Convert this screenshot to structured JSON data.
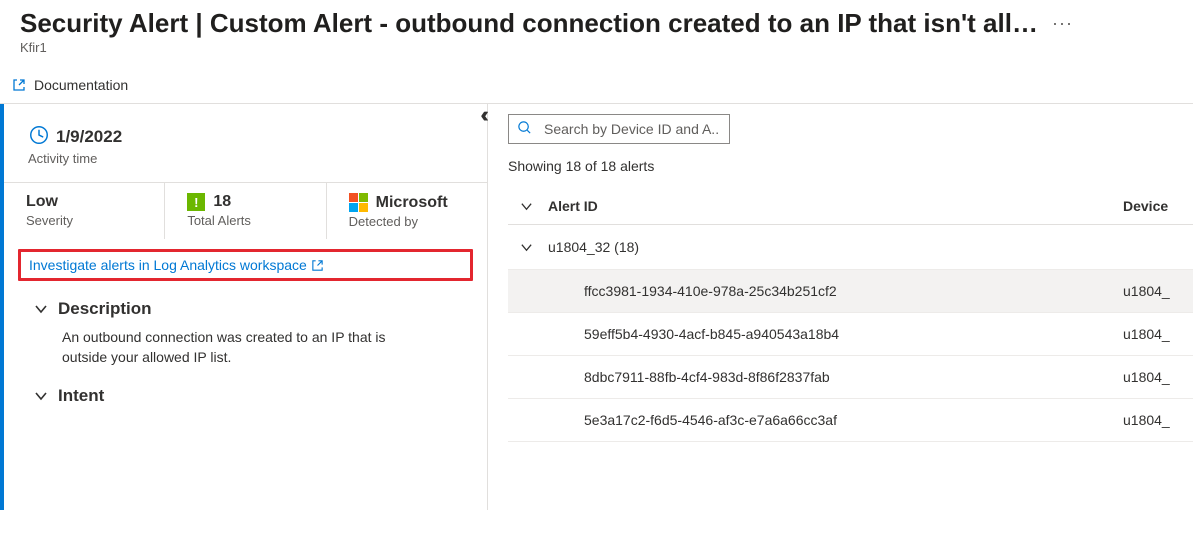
{
  "header": {
    "title": "Security Alert | Custom Alert - outbound connection created to an IP that isn't allowed",
    "subtitle": "Kfir1",
    "more_label": "···"
  },
  "toolbar": {
    "documentation_label": "Documentation"
  },
  "left": {
    "activity_date": "1/9/2022",
    "activity_label": "Activity time",
    "severity_value": "Low",
    "severity_label": "Severity",
    "total_alerts_value": "18",
    "total_alerts_label": "Total Alerts",
    "detected_value": "Microsoft",
    "detected_label": "Detected by",
    "investigate_link": "Investigate alerts in Log Analytics workspace",
    "description_head": "Description",
    "description_body": "An outbound connection was created to an IP that is outside your allowed IP list.",
    "intent_head": "Intent"
  },
  "right": {
    "search_placeholder": "Search by Device ID and A...",
    "results_count": "Showing 18 of 18 alerts",
    "columns": {
      "alert_id": "Alert ID",
      "device": "Device "
    },
    "group": {
      "label": "u1804_32 (18)"
    },
    "rows": [
      {
        "alert_id": "ffcc3981-1934-410e-978a-25c34b251cf2",
        "device": "u1804_"
      },
      {
        "alert_id": "59eff5b4-4930-4acf-b845-a940543a18b4",
        "device": "u1804_"
      },
      {
        "alert_id": "8dbc7911-88fb-4cf4-983d-8f86f2837fab",
        "device": "u1804_"
      },
      {
        "alert_id": "5e3a17c2-f6d5-4546-af3c-e7a6a66cc3af",
        "device": "u1804_"
      }
    ]
  }
}
